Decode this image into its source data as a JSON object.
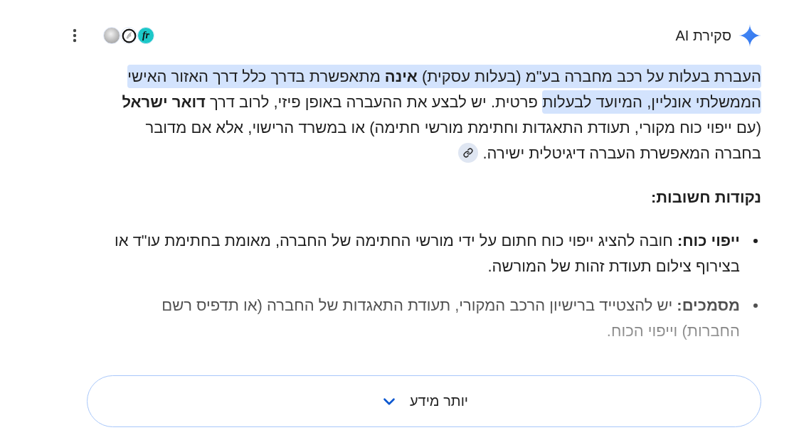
{
  "header": {
    "title": "סקירת AI",
    "sources": [
      {
        "kind": "text_logo",
        "text": "fr"
      },
      {
        "kind": "wing"
      },
      {
        "kind": "sphere"
      }
    ]
  },
  "summary": {
    "segments": [
      {
        "text": "העברת בעלות על רכב מחברה בע\"מ (בעלות עסקית) **אינה** מתאפשרת בדרך כלל דרך האזור האישי הממשלתי אונליין, המיועד לבעלות",
        "highlighted": true
      },
      {
        "text": " פרטית. יש לבצע את ההעברה באופן פיזי, לרוב דרך **דואר ישראל** (עם ייפוי כוח מקורי, תעודת התאגדות וחתימת מורשי חתימה) או במשרד הרישוי, אלא אם מדובר בחברה המאפשרת העברה דיגיטלית ישירה.",
        "highlighted": false
      }
    ]
  },
  "key_points": {
    "heading": "נקודות חשובות:",
    "items": [
      "**ייפוי כוח:** חובה להציג ייפוי כוח חתום על ידי מורשי החתימה של החברה, מאומת בחתימת עו\"ד או בצירוף צילום תעודת זהות של המורשה.",
      "**מסמכים:** יש להצטייד ברישיון הרכב המקורי, תעודת התאגדות של החברה (או תדפיס רשם החברות) וייפוי הכוח."
    ]
  },
  "more_button": {
    "label": "יותר מידע"
  }
}
